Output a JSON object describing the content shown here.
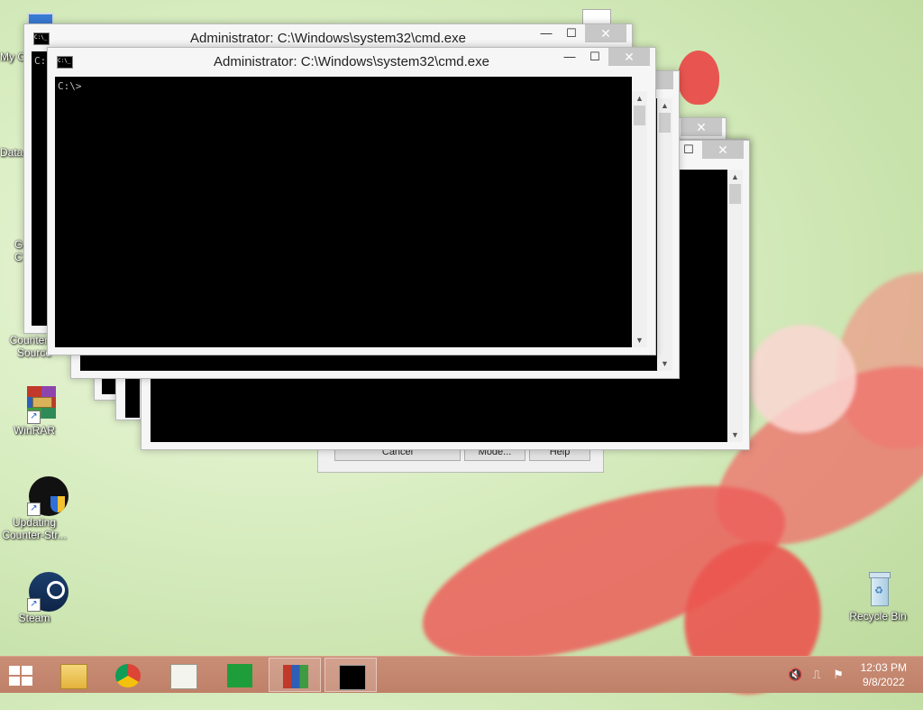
{
  "desktop": {
    "icons": [
      {
        "label": "My C",
        "icon": "my-computer-icon"
      },
      {
        "label": "Data",
        "icon": "database-icon"
      },
      {
        "label": "G\nC",
        "icon": "chrome-icon"
      },
      {
        "label": "Counter-S\nSource",
        "icon": "counter-strike-source-icon"
      },
      {
        "label": "WinRAR",
        "icon": "winrar-icon"
      },
      {
        "label": "Updating\nCounter-Str...",
        "icon": "counter-strike-update-icon"
      },
      {
        "label": "Steam",
        "icon": "steam-icon"
      },
      {
        "label": "Recycle Bin",
        "icon": "recycle-bin-icon"
      }
    ]
  },
  "windows": {
    "back": {
      "title": "Administrator: C:\\Windows\\system32\\cmd.exe",
      "console_text": "C:\\>"
    },
    "front": {
      "title": "Administrator: C:\\Windows\\system32\\cmd.exe",
      "console_text": "C:\\>"
    },
    "minimize_glyph": "—",
    "maximize_glyph": "☐",
    "close_glyph": "✕"
  },
  "dialog": {
    "buttons": [
      "Cancel",
      "Mode...",
      "Help"
    ]
  },
  "taskbar": {
    "apps": [
      {
        "name": "File Explorer",
        "icon": "file-explorer-icon"
      },
      {
        "name": "Google Chrome",
        "icon": "chrome-icon"
      },
      {
        "name": "Notepad++",
        "icon": "notepad-plus-plus-icon"
      },
      {
        "name": "Store",
        "icon": "store-icon"
      },
      {
        "name": "WinRAR",
        "icon": "winrar-icon"
      },
      {
        "name": "Command Prompt",
        "icon": "cmd-icon",
        "active": true
      }
    ],
    "tray_icons": [
      "volume-muted-icon",
      "network-icon",
      "action-center-icon"
    ],
    "clock": {
      "time": "12:03 PM",
      "date": "9/8/2022"
    }
  }
}
